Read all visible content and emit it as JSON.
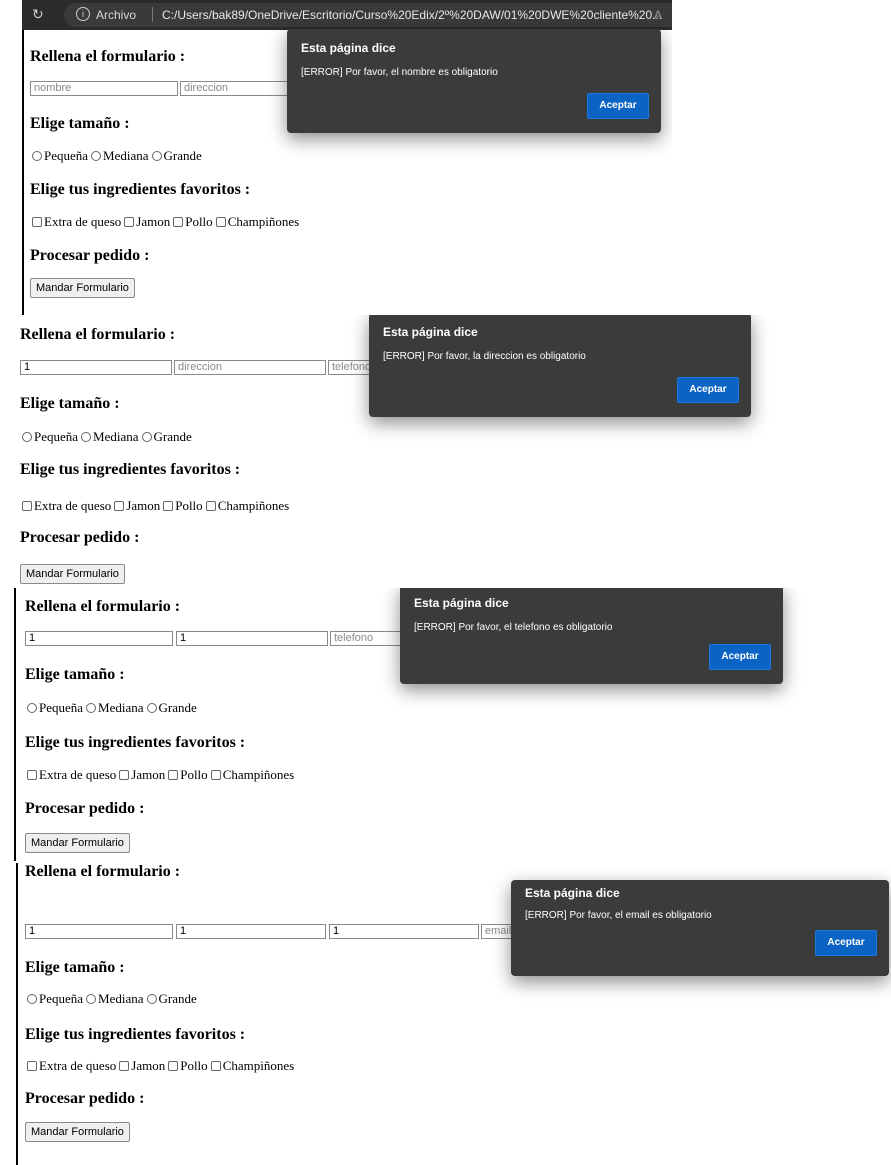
{
  "browser": {
    "reload_icon": "reload-icon",
    "info_icon": "info-icon",
    "archivo_label": "Archivo",
    "url": "C:/Users/bak89/OneDrive/Escritorio/Curso%20Edix/2º%20DAW/01%20DWE%20cliente%20...",
    "reader_label": "A"
  },
  "form": {
    "heading_rellena": "Rellena el formulario :",
    "heading_tamano": "Elige tamaño :",
    "heading_ingredientes": "Elige tus ingredientes favoritos :",
    "heading_procesar": "Procesar pedido :",
    "placeholders": {
      "nombre": "nombre",
      "direccion": "direccion",
      "telefono": "telefono",
      "email": "email"
    },
    "sizes": [
      "Pequeña",
      "Mediana",
      "Grande"
    ],
    "ingredients": [
      "Extra de queso",
      "Jamon",
      "Pollo",
      "Champiñones"
    ],
    "submit_label": "Mandar Formulario"
  },
  "dialog_common": {
    "title": "Esta página dice",
    "accept_label": "Aceptar"
  },
  "panels": [
    {
      "values": {
        "nombre": "",
        "direccion": ""
      },
      "error": "[ERROR] Por favor, el nombre es obligatorio"
    },
    {
      "values": {
        "nombre": "1",
        "direccion": "",
        "telefono": ""
      },
      "error": "[ERROR] Por favor, la direccion es obligatorio"
    },
    {
      "values": {
        "nombre": "1",
        "direccion": "1",
        "telefono": ""
      },
      "error": "[ERROR] Por favor, el telefono es obligatorio"
    },
    {
      "values": {
        "nombre": "1",
        "direccion": "1",
        "telefono": "1",
        "email": ""
      },
      "error": "[ERROR] Por favor, el email es obligatorio"
    }
  ]
}
